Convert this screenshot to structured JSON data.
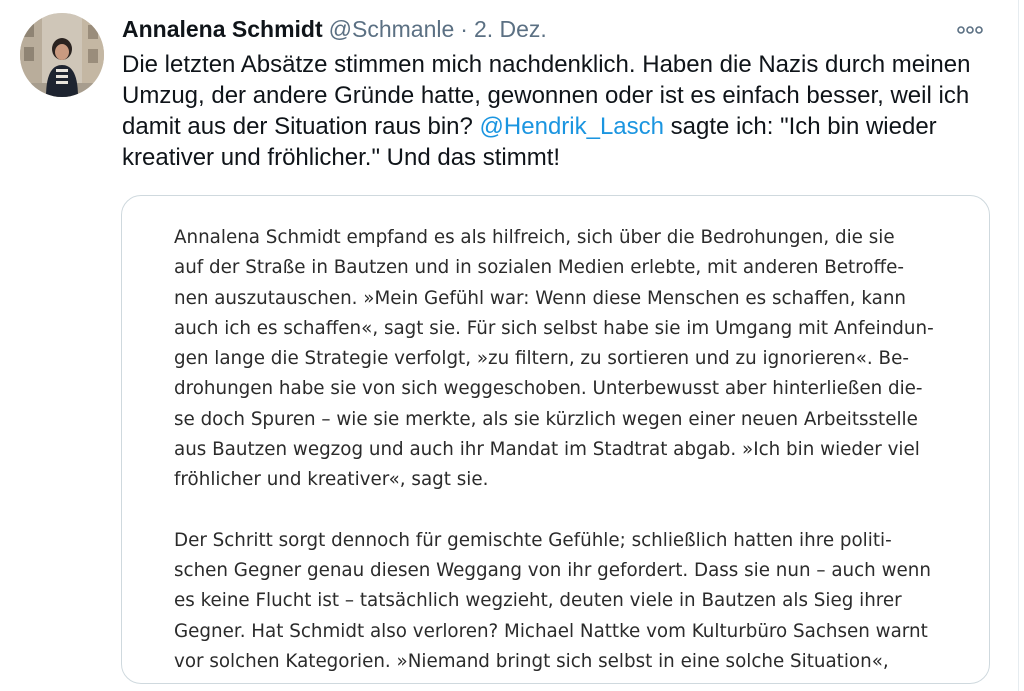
{
  "tweet": {
    "author_name": "Annalena Schmidt",
    "handle": "@Schmanle",
    "separator": "·",
    "date": "2. Dez.",
    "text_before_mention": "Die letzten Absätze stimmen mich nachdenklich. Haben die Nazis durch meinen Umzug, der andere Gründe hatte, gewonnen oder ist es einfach besser, weil ich damit aus der Situation raus bin? ",
    "mention": "@Hendrik_Lasch",
    "text_after_mention": " sagte ich: \"Ich bin wieder kreativer und fröhlicher.\" Und das stimmt!"
  },
  "colors": {
    "link": "#1b95e0",
    "secondary_text": "#5b7083",
    "card_border": "#cfd9de"
  },
  "icons": {
    "more": "more-horizontal-icon"
  },
  "article": {
    "paragraph1": [
      "Annalena Schmidt empfand es als hilfreich, sich über die Bedrohungen, die sie",
      "auf der Straße in Bautzen und in sozialen Medien erlebte, mit anderen Betroffe-",
      "nen auszutauschen. »Mein Gefühl war: Wenn diese Menschen es schaffen, kann",
      "auch ich es schaffen«, sagt sie. Für sich selbst habe sie im Umgang mit Anfeindun-",
      "gen lange die Strategie verfolgt, »zu filtern, zu sortieren und zu ignorieren«. Be-",
      "drohungen habe sie von sich weggeschoben. Unterbewusst aber hinterließen die-",
      "se doch Spuren – wie sie merkte, als sie kürzlich wegen einer neuen Arbeitsstelle",
      "aus Bautzen wegzog und auch ihr Mandat im Stadtrat abgab. »Ich bin wieder viel",
      "fröhlicher und kreativer«, sagt sie."
    ],
    "paragraph2": [
      "Der Schritt sorgt dennoch für gemischte Gefühle; schließlich hatten ihre politi-",
      "schen Gegner genau diesen Weggang von ihr gefordert. Dass sie nun – auch wenn",
      "es keine Flucht ist – tatsächlich wegzieht, deuten viele in Bautzen als Sieg ihrer",
      "Gegner. Hat Schmidt also verloren? Michael Nattke vom Kulturbüro Sachsen warnt",
      "vor solchen Kategorien. »Niemand bringt sich selbst in eine solche Situation«,"
    ]
  }
}
